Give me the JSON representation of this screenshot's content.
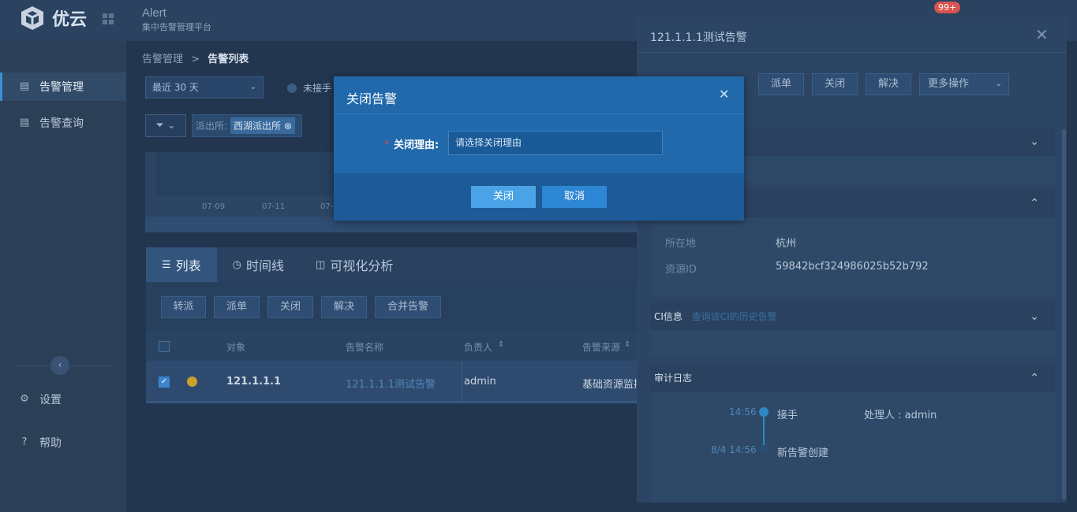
{
  "header": {
    "brand": "优云",
    "app_title": "Alert",
    "app_subtitle": "集中告警管理平台",
    "notification_count": "99+"
  },
  "sidebar": {
    "items": [
      {
        "label": "告警管理",
        "icon": "doc-icon"
      },
      {
        "label": "告警查询",
        "icon": "doc-icon"
      }
    ],
    "bottom": [
      {
        "label": "设置",
        "icon": "gear-icon"
      },
      {
        "label": "帮助",
        "icon": "help-icon"
      }
    ]
  },
  "breadcrumb": {
    "parent": "告警管理",
    "sep": ">",
    "current": "告警列表"
  },
  "filters": {
    "time_range": "最近 30 天",
    "status_radio": "未接手",
    "tag_prefix": "派出所:",
    "tag_value": "西湖派出所"
  },
  "timeline": {
    "ticks": [
      "07-09",
      "07-11",
      "07-"
    ]
  },
  "tabs": [
    {
      "label": "列表",
      "icon": "list-icon"
    },
    {
      "label": "时间线",
      "icon": "clock-icon"
    },
    {
      "label": "可视化分析",
      "icon": "chart-icon"
    }
  ],
  "actions": [
    "转派",
    "派单",
    "关闭",
    "解决",
    "合并告警"
  ],
  "table": {
    "headers": [
      "对象",
      "告警名称",
      "负责人",
      "告警来源"
    ],
    "rows": [
      {
        "object": "121.1.1.1",
        "name": "121.1.1.1测试告警",
        "owner": "admin",
        "source": "基础资源监控"
      }
    ]
  },
  "drawer": {
    "title": "121.1.1.1测试告警",
    "buttons": [
      "派单",
      "关闭",
      "解决",
      "更多操作"
    ],
    "location_label": "所在地",
    "location_value": "杭州",
    "resource_label": "资源ID",
    "resource_value": "59842bcf324986025b52b792",
    "ci_title": "CI信息",
    "ci_link": "查询该CI的历史告警",
    "audit_title": "审计日志",
    "audit": [
      {
        "time": "14:56",
        "action": "接手",
        "detail": "处理人 : admin"
      },
      {
        "time": "8/4 14:56",
        "action": "新告警创建",
        "detail": ""
      }
    ]
  },
  "modal": {
    "title": "关闭告警",
    "field_label": "关闭理由:",
    "field_placeholder": "请选择关闭理由",
    "confirm_label": "关闭",
    "cancel_label": "取消"
  }
}
